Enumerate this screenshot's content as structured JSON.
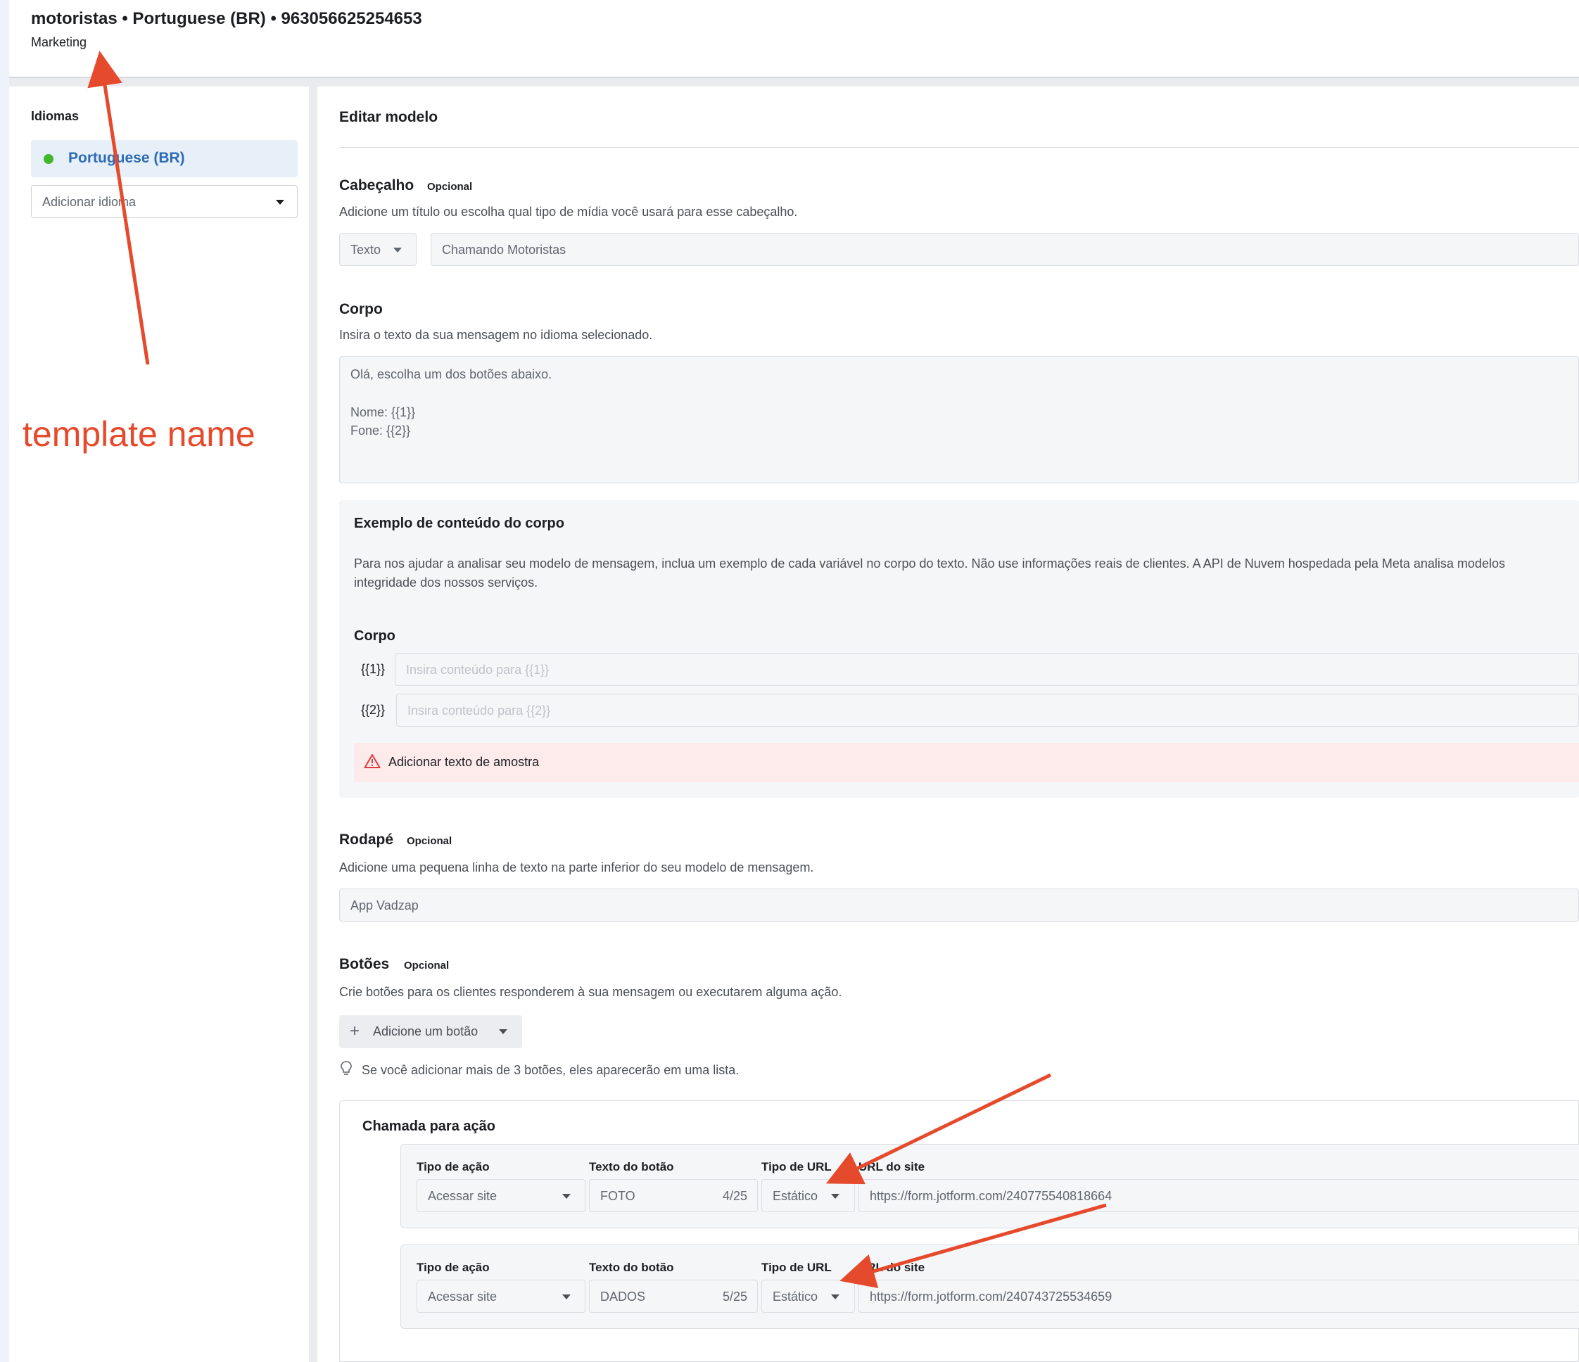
{
  "header": {
    "title": "motoristas • Portuguese (BR) • 963056625254653",
    "category": "Marketing"
  },
  "sidebar": {
    "label": "Idiomas",
    "selected_language": "Portuguese (BR)",
    "add_language_placeholder": "Adicionar idioma"
  },
  "annotation": {
    "text": "template name",
    "color": "#e64a2c"
  },
  "editor": {
    "title": "Editar modelo",
    "header_section": {
      "title": "Cabeçalho",
      "optional": "Opcional",
      "description": "Adicione um título ou escolha qual tipo de mídia você usará para esse cabeçalho.",
      "type": "Texto",
      "value": "Chamando Motoristas"
    },
    "body_section": {
      "title": "Corpo",
      "description": "Insira o texto da sua mensagem no idioma selecionado.",
      "lines": [
        "Olá, escolha um dos botões abaixo.",
        "",
        "Nome: {{1}}",
        "Fone: {{2}}"
      ]
    },
    "example": {
      "title": "Exemplo de conteúdo do corpo",
      "desc_line1": "Para nos ajudar a analisar seu modelo de mensagem, inclua um exemplo de cada variável no corpo do texto. Não use informações reais de clientes. A API de Nuvem hospedada pela Meta analisa modelos",
      "desc_line2": "integridade dos nossos serviços.",
      "body_label": "Corpo",
      "vars": [
        {
          "label": "{{1}}",
          "placeholder": "Insira conteúdo para {{1}}"
        },
        {
          "label": "{{2}}",
          "placeholder": "Insira conteúdo para {{2}}"
        }
      ],
      "warning": "Adicionar texto de amostra"
    },
    "footer_section": {
      "title": "Rodapé",
      "optional": "Opcional",
      "description": "Adicione uma pequena linha de texto na parte inferior do seu modelo de mensagem.",
      "value": "App Vadzap"
    },
    "buttons_section": {
      "title": "Botões",
      "optional": "Opcional",
      "description": "Crie botões para os clientes responderem à sua mensagem ou executarem alguma ação.",
      "add_button": "Adicione um botão",
      "tip": "Se você adicionar mais de 3 botões, eles aparecerão em uma lista."
    },
    "cta": {
      "title": "Chamada para ação",
      "col_action": "Tipo de ação",
      "col_text": "Texto do botão",
      "col_url_type": "Tipo de URL",
      "col_url": "URL do site",
      "rows": [
        {
          "action": "Acessar site",
          "text": "FOTO",
          "count": "4/25",
          "url_type": "Estático",
          "url": "https://form.jotform.com/240775540818664"
        },
        {
          "action": "Acessar site",
          "text": "DADOS",
          "count": "5/25",
          "url_type": "Estático",
          "url": "https://form.jotform.com/240743725534659"
        }
      ]
    }
  }
}
